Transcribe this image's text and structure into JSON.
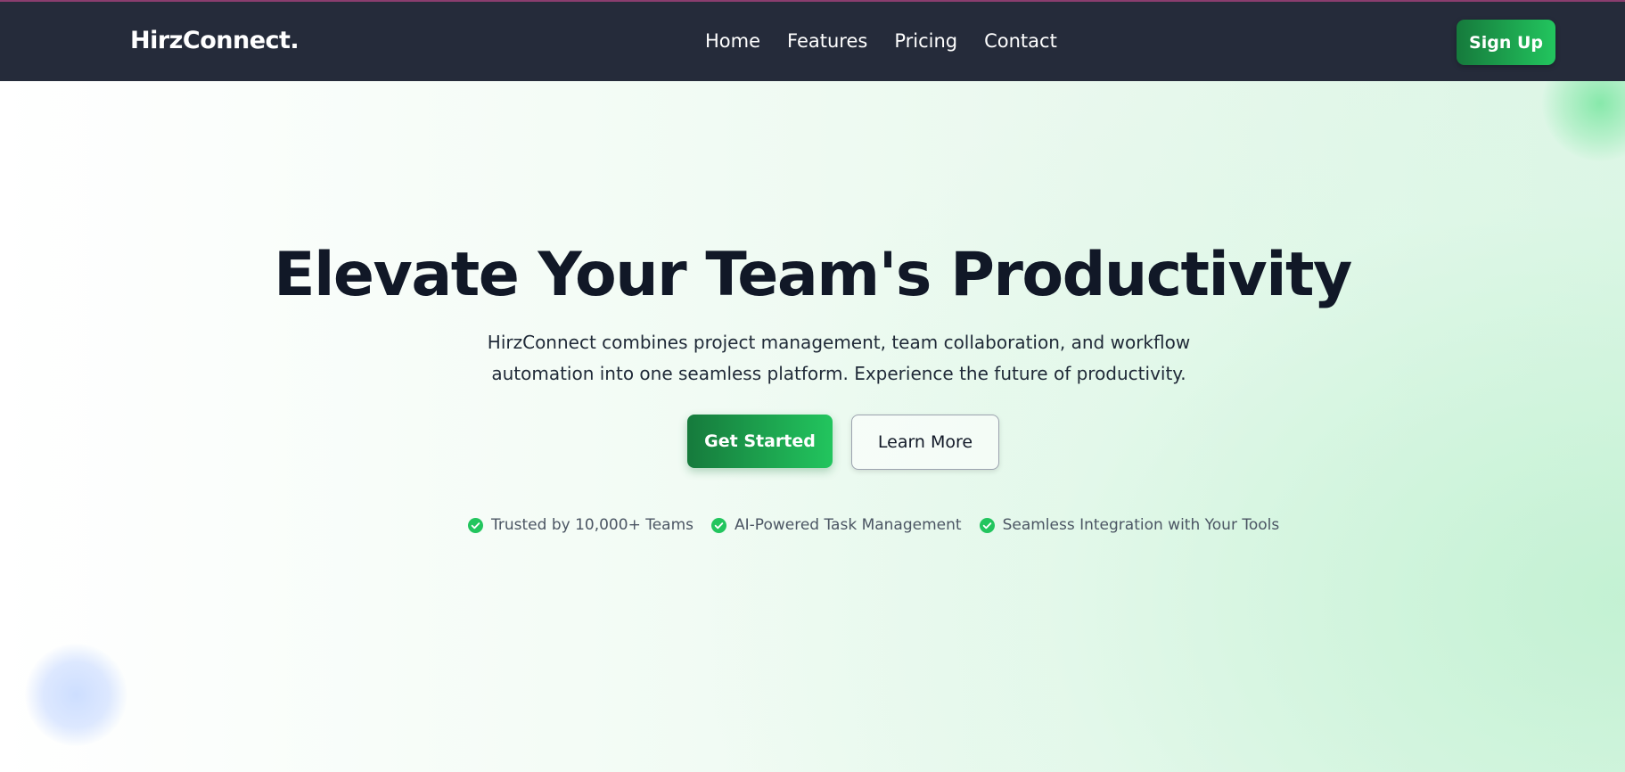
{
  "header": {
    "brand": "HirzConnect.",
    "nav": [
      "Home",
      "Features",
      "Pricing",
      "Contact"
    ],
    "signup_label": "Sign Up"
  },
  "hero": {
    "title": "Elevate Your Team's Productivity",
    "subtitle": "HirzConnect combines project management, team collaboration, and workflow automation into one seamless platform. Experience the future of productivity.",
    "primary_cta": "Get Started",
    "secondary_cta": "Learn More",
    "features": [
      {
        "icon": "check-circle-icon",
        "label": "Trusted by 10,000+ Teams"
      },
      {
        "icon": "check-circle-icon",
        "label": "AI-Powered Task Management"
      },
      {
        "icon": "check-circle-icon",
        "label": "Seamless Integration with Your Tools"
      }
    ]
  },
  "colors": {
    "nav_bg": "#252b3a",
    "accent_start": "#167a3c",
    "accent_end": "#22c55e",
    "title_text": "#111827",
    "check_green": "#22c55e"
  }
}
